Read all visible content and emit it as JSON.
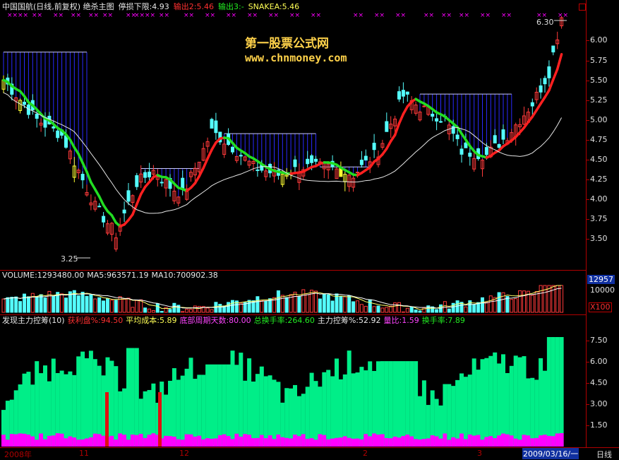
{
  "main": {
    "header": {
      "title": "中国国航(日线,前复权) 绝杀主图",
      "stop_loss": "停损下限:4.93",
      "out2": "输出2:5.46",
      "out3": "输出3:-",
      "snakea": "SNAKEA:5.46"
    },
    "watermark": {
      "line1": "第一股票公式网",
      "line2": "www.chnmoney.com"
    },
    "annotations": {
      "high": "6.30",
      "low": "3.25"
    },
    "y_ticks": [
      "6.00",
      "5.75",
      "5.50",
      "5.25",
      "5.00",
      "4.75",
      "4.50",
      "4.25",
      "4.00",
      "3.75",
      "3.50"
    ],
    "marker_symbol": "××"
  },
  "volume": {
    "header": {
      "volume": "VOLUME:1293480.00",
      "ma5": "MA5:963571.19",
      "ma10": "MA10:700902.38"
    },
    "y_ticks": [
      "12957",
      "10000"
    ],
    "unit": "X100"
  },
  "indicator": {
    "header": {
      "name": "发现主力控筹(10)",
      "profit": "获利盘%:94.50",
      "avg_cost": "平均成本:5.89",
      "bottom_days": "底部周期天数:80.00",
      "turnover_total": "总换手率:264.60",
      "control": "主力控筹%:52.92",
      "vol_ratio": "量比:1.59",
      "turnover": "换手率:7.89"
    },
    "y_ticks": [
      "7.50",
      "6.00",
      "4.50",
      "3.00",
      "1.50"
    ]
  },
  "dates": {
    "year": "2008年",
    "m11": "11",
    "m12": "12",
    "m2": "2",
    "m3": "3",
    "current": "2009/03/16/一",
    "period": "日线"
  },
  "colors": {
    "up": "#ff3a3a",
    "down": "#54ffff",
    "green": "#22dd22",
    "red": "#ff2020",
    "magenta": "#ff00ff",
    "spring": "#00ee88",
    "blue": "#2a2aff"
  }
}
